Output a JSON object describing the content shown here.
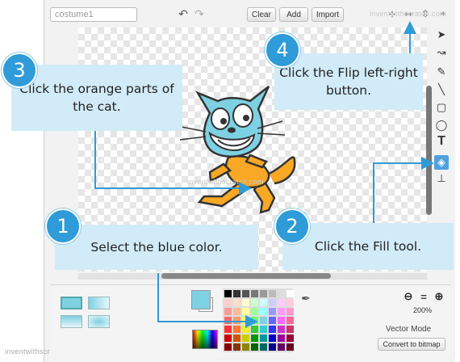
{
  "editor": {
    "costume_name": "costume1",
    "toolbar": {
      "clear": "Clear",
      "add": "Add",
      "import": "Import"
    },
    "zoom_level": "200%",
    "mode_label": "Vector Mode",
    "convert_button": "Convert to bitmap",
    "watermark": "inventwithscratch.com",
    "selected_color": "#7ed0e3"
  },
  "callouts": [
    {
      "number": "1",
      "text": "Select the blue color."
    },
    {
      "number": "2",
      "text": "Click the Fill tool."
    },
    {
      "number": "3",
      "text": "Click the orange parts of the cat."
    },
    {
      "number": "4",
      "text": "Click the Flip left-right button."
    }
  ],
  "tools": [
    "pointer-icon",
    "reshape-icon",
    "pencil-icon",
    "line-icon",
    "rectangle-icon",
    "ellipse-icon",
    "text-icon",
    "fill-icon",
    "stamp-icon"
  ],
  "colors": {
    "callout_bg": "#d2ebf8",
    "badge": "#2f9bd8",
    "arrow": "#2f9bd8"
  }
}
